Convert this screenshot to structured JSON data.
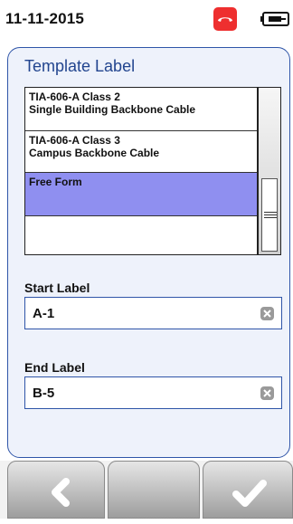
{
  "status": {
    "date": "11-11-2015",
    "icons": [
      "phone-hangup-icon",
      "battery-icon"
    ],
    "accent_color": "#ee2f2f"
  },
  "panel": {
    "title": "Template Label",
    "list": {
      "items": [
        {
          "line1": "TIA-606-A Class 2",
          "line2": "Single Building Backbone Cable",
          "selected": false
        },
        {
          "line1": "TIA-606-A Class 3",
          "line2": "Campus Backbone Cable",
          "selected": false
        },
        {
          "line1": "Free Form",
          "line2": "",
          "selected": true
        }
      ],
      "selected_color": "#8f8ff0"
    },
    "start": {
      "label": "Start Label",
      "value": "A-1"
    },
    "end": {
      "label": "End Label",
      "value": "B-5"
    }
  },
  "bottom": {
    "back_icon": "chevron-left-icon",
    "confirm_icon": "checkmark-icon"
  }
}
